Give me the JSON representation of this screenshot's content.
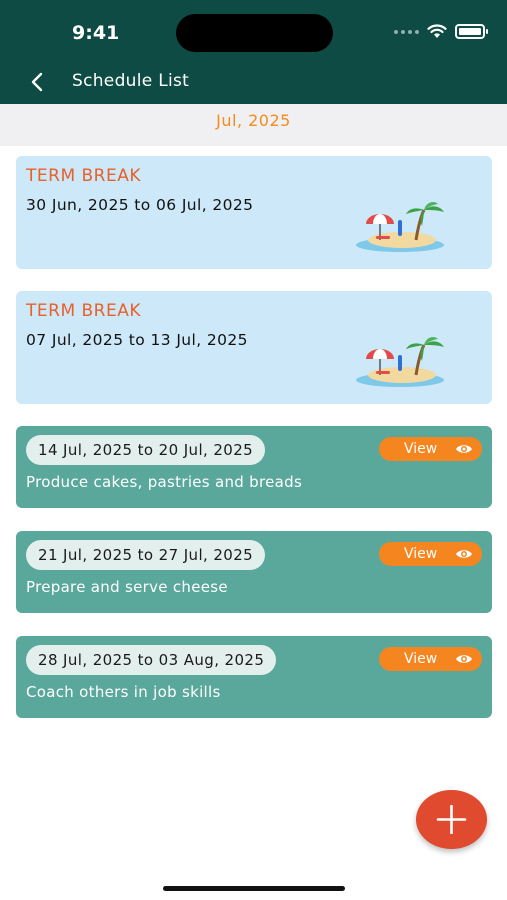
{
  "status_bar": {
    "time": "9:41"
  },
  "header": {
    "title": "Schedule List",
    "back_icon": "chevron-left-icon"
  },
  "month": {
    "label": "Jul, 2025"
  },
  "term_breaks": [
    {
      "title": "TERM BREAK",
      "range": "30 Jun, 2025 to 06 Jul, 2025",
      "icon": "beach-island-icon"
    },
    {
      "title": "TERM BREAK",
      "range": "07 Jul, 2025 to 13 Jul, 2025",
      "icon": "beach-island-icon"
    }
  ],
  "schedules": [
    {
      "range": "14 Jul, 2025 to 20 Jul, 2025",
      "description": "Produce cakes, pastries and breads",
      "view_label": "View"
    },
    {
      "range": "21 Jul, 2025 to 27 Jul, 2025",
      "description": "Prepare and serve cheese",
      "view_label": "View"
    },
    {
      "range": "28 Jul, 2025 to 03 Aug, 2025",
      "description": "Coach others in job skills",
      "view_label": "View"
    }
  ],
  "fab": {
    "icon": "plus-icon"
  },
  "colors": {
    "header_bg": "#0d4b44",
    "accent_orange": "#f58a1f",
    "break_card_bg": "#cde8f8",
    "break_title": "#e8602a",
    "task_card_bg": "#5aa89c",
    "view_button": "#f5851e",
    "fab_red": "#e04a2e"
  }
}
